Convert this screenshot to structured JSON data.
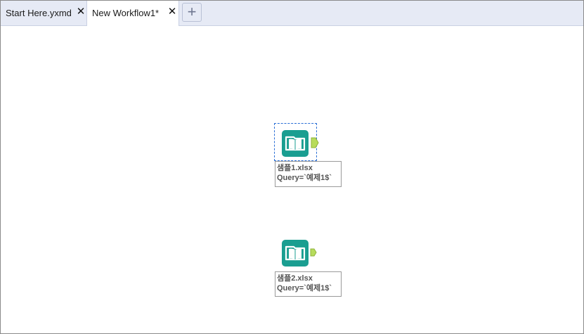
{
  "tabs": [
    {
      "label": "Start Here.yxmd",
      "close": "✕",
      "active": false
    },
    {
      "label": "New Workflow1*",
      "close": "✕",
      "active": true
    }
  ],
  "new_tab_label": "+",
  "tools": [
    {
      "icon": "input-data-book-icon",
      "selected": true,
      "label_line1": "샘플1.xlsx",
      "label_line2": "Query=`예제1$`"
    },
    {
      "icon": "input-data-book-icon",
      "selected": false,
      "label_line1": "샘플2.xlsx",
      "label_line2": "Query=`예제1$`"
    }
  ],
  "colors": {
    "tool_teal": "#1a9e91",
    "anchor_green": "#b7dc5c",
    "selection": "#2a6fd6",
    "tabbar": "#e6eaf5"
  }
}
